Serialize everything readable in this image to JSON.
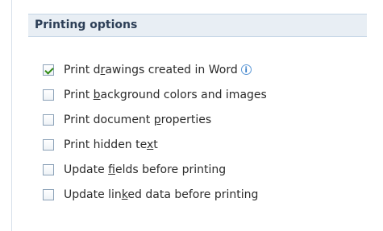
{
  "section": {
    "title": "Printing options"
  },
  "options": [
    {
      "before": "Print d",
      "accel": "r",
      "after": "awings created in Word",
      "checked": true,
      "info_icon": "info-icon"
    },
    {
      "before": "Print ",
      "accel": "b",
      "after": "ackground colors and images",
      "checked": false
    },
    {
      "before": "Print document ",
      "accel": "p",
      "after": "roperties",
      "checked": false
    },
    {
      "before": "Print hidden te",
      "accel": "x",
      "after": "t",
      "checked": false
    },
    {
      "before": "Update ",
      "accel": "f",
      "after": "ields before printing",
      "checked": false
    },
    {
      "before": "Update lin",
      "accel": "k",
      "after": "ed data before printing",
      "checked": false
    }
  ],
  "colors": {
    "header_bg": "#e8eef4",
    "header_text": "#2d3f57",
    "checkmark": "#2f8a12",
    "info": "#2f78c6"
  },
  "info_glyph": "i"
}
